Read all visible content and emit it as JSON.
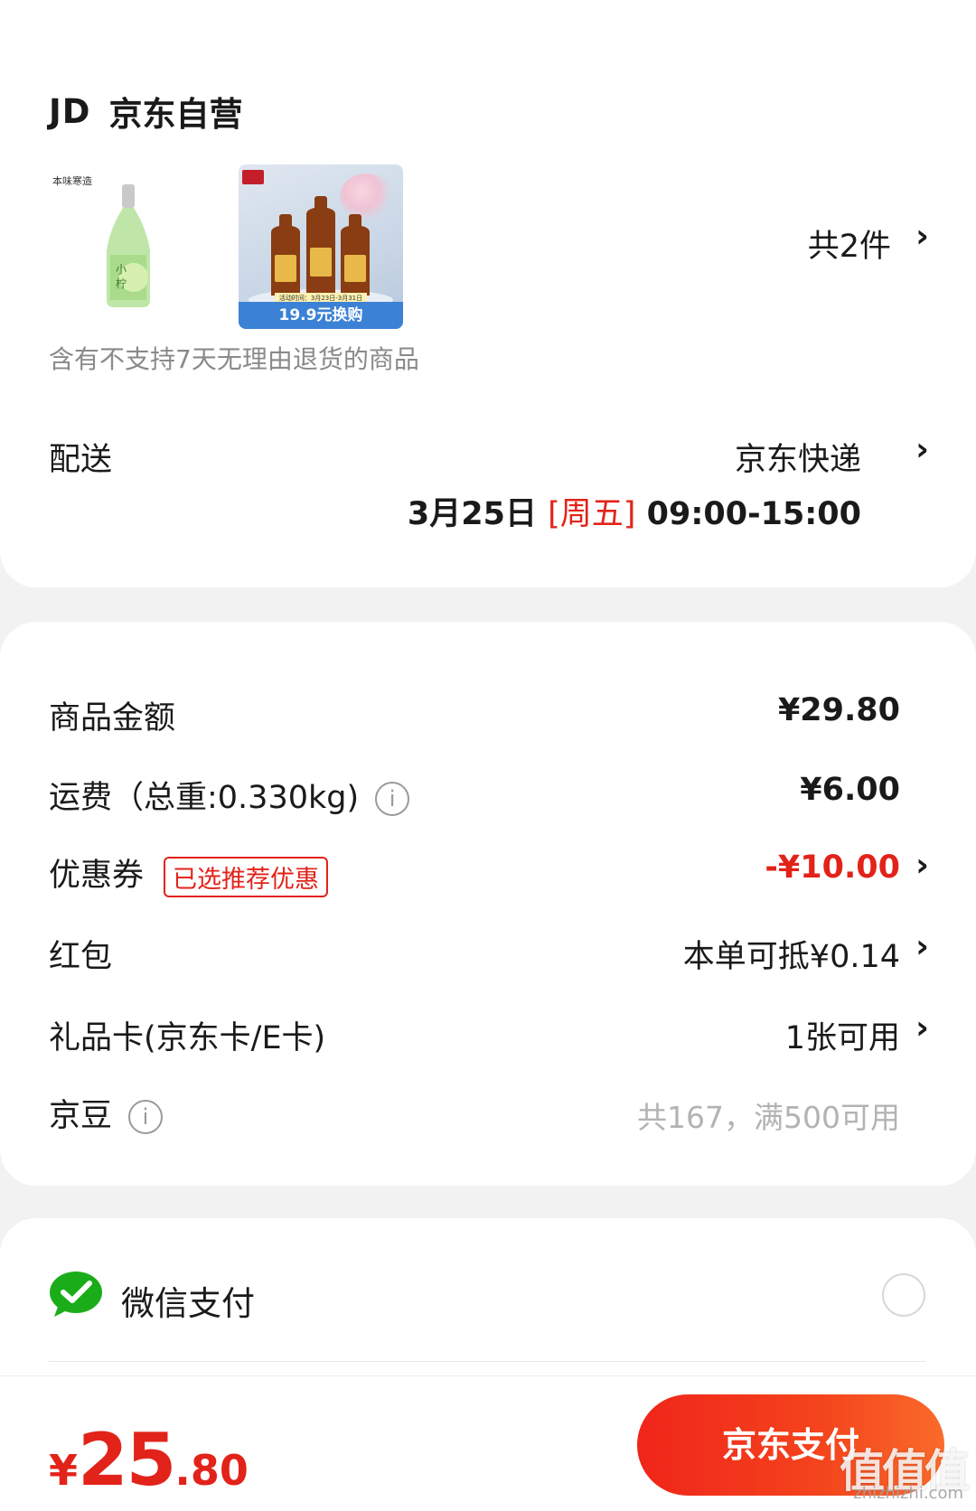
{
  "store": {
    "logo_text": "JD",
    "name": "京东自营"
  },
  "items": {
    "thumb1_tag": "本味寒造",
    "thumb2_badge_top": "活动时间：3月23日-3月31日",
    "thumb2_badge": "19.9元换购",
    "count_label": "共2件"
  },
  "notice": "含有不支持7天无理由退货的商品",
  "delivery": {
    "label": "配送",
    "method": "京东快递",
    "date": "3月25日",
    "weekday": "[周五]",
    "time": "09:00-15:00"
  },
  "costs": {
    "goods": {
      "label": "商品金额",
      "value": "¥29.80"
    },
    "shipping": {
      "label": "运费（总重:0.330kg)",
      "value": "¥6.00"
    },
    "coupon": {
      "label": "优惠券",
      "tag": "已选推荐优惠",
      "value": "-¥10.00"
    },
    "redpacket": {
      "label": "红包",
      "value": "本单可抵¥0.14"
    },
    "giftcard": {
      "label": "礼品卡(京东卡/E卡)",
      "value": "1张可用"
    },
    "jingdou": {
      "label": "京豆",
      "value": "共167，满500可用"
    }
  },
  "payment": {
    "method_label": "微信支付"
  },
  "footer": {
    "currency": "¥",
    "total_int": "25",
    "total_dec": ".80",
    "pay_button": "京东支付",
    "watermark": "值值值",
    "watermark_url": "zhizhizhi.com"
  },
  "colors": {
    "accent": "#e2231a",
    "wechat": "#1aad19"
  },
  "icons": {
    "chevron": "chevron-right-icon",
    "info": "info-icon",
    "wechat": "wechat-pay-icon"
  }
}
